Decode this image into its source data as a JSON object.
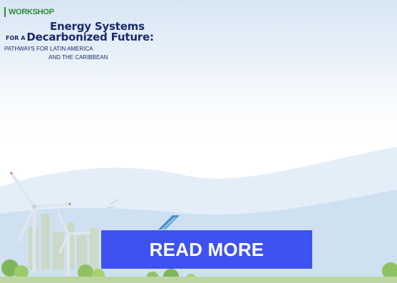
{
  "banner": {
    "tag": "WORKSHOP",
    "title_line1": "Energy Systems",
    "title_prefix": "FOR A",
    "title_line2": "Decarbonized Future:",
    "subtitle_line1": "PATHWAYS FOR LATIN AMERICA",
    "subtitle_line2": "AND THE CARIBBEAN"
  },
  "cta": {
    "label": "READ MORE",
    "color": "#3d52f0"
  },
  "colors": {
    "tag_green": "#2e8b3a",
    "title_navy": "#1b2a6b",
    "hill_blue": "#cfe0f0"
  }
}
